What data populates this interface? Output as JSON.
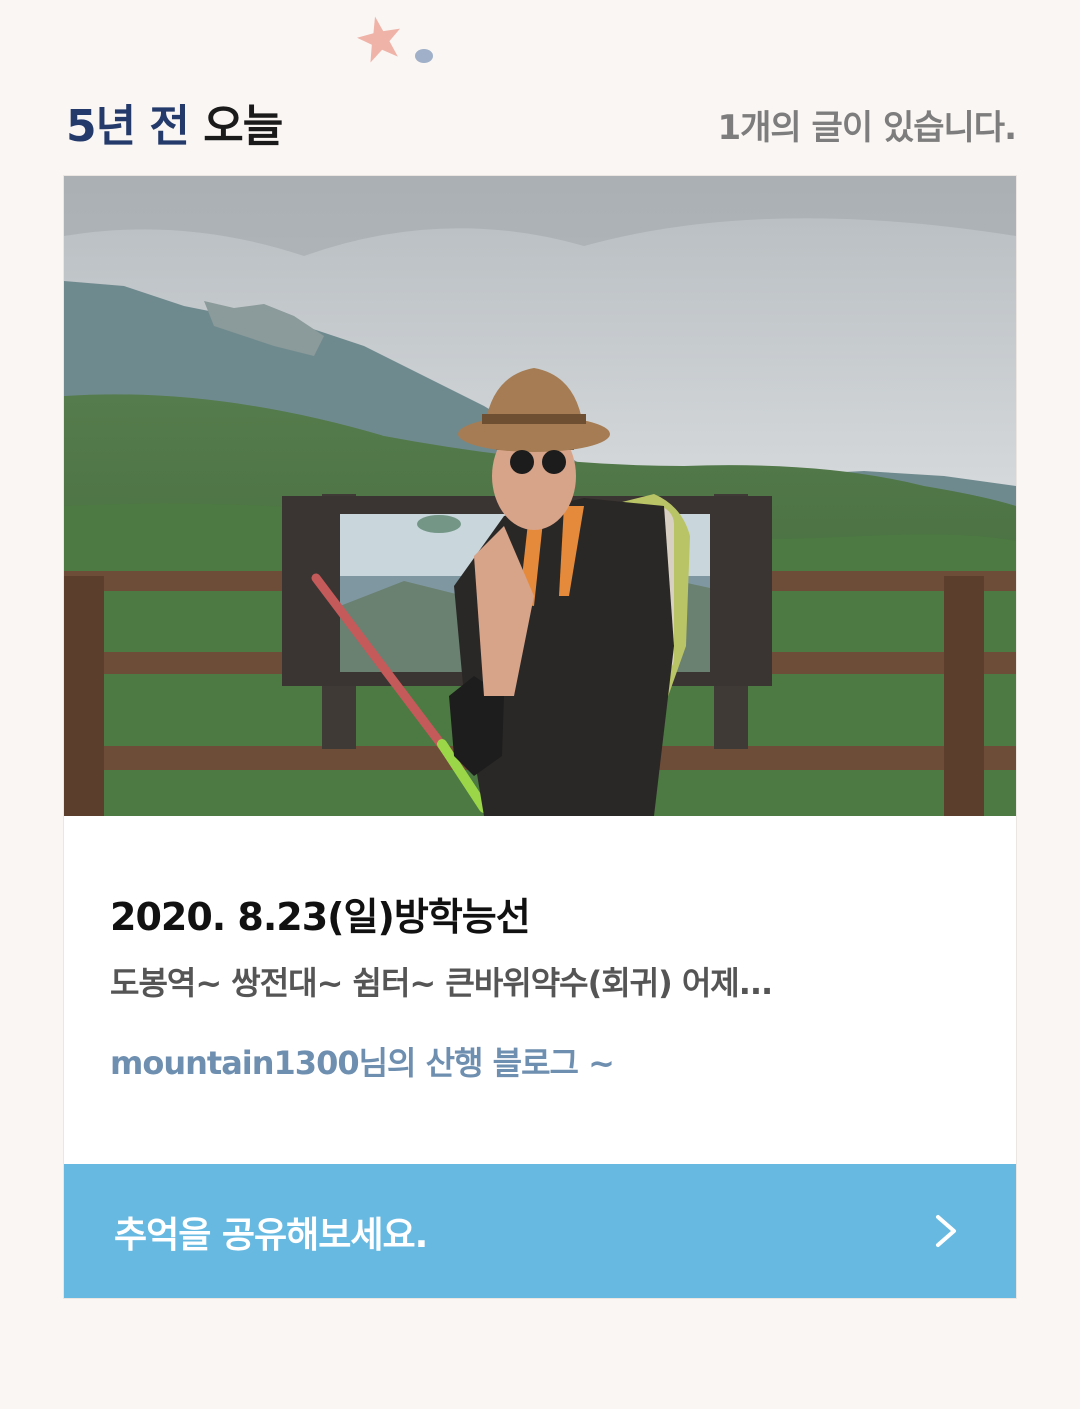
{
  "header": {
    "title_years": "5년 전",
    "title_today": "오늘",
    "count_text": "1개의 글이 있습니다."
  },
  "card": {
    "photo_alt": "mountain hiker photo",
    "post_title": "2020. 8.23(일)방학능선",
    "excerpt": "도봉역~ 쌍전대~ 쉼터~ 큰바위약수(회귀) 어제...",
    "blog_name": "mountain1300님의 산행 블로그 ~"
  },
  "share": {
    "label": "추억을 공유해보세요."
  },
  "icons": {
    "decoration": "star-decoration-icon",
    "chevron": "chevron-right-icon"
  },
  "colors": {
    "background": "#faf6f3",
    "title_accent": "#233a6b",
    "share_bar": "#67b9e2",
    "blog_link": "#6f8fb0"
  }
}
